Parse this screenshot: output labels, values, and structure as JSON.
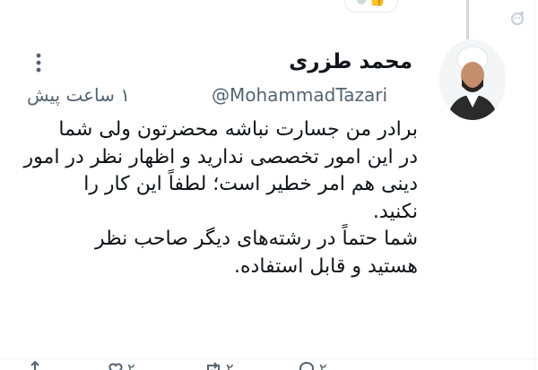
{
  "post": {
    "display_name": "محمد طزری",
    "handle": "@MohammadTazari",
    "time": "۱ ساعت پیش",
    "body": "برادر من جسارت نباشه محضرتون ولی شما\nدر این امور تخصصی ندارید و اظهار نظر در امور\nدینی هم امر خطیر است؛ لطفاً این کار را\nنکنید.\nشما حتماً در رشته‌های دیگر صاحب نظر\nهستید و قابل استفاده."
  },
  "actions": {
    "reply_count": "۲",
    "retweet_count": "۲",
    "like_count": "۲"
  },
  "colors": {
    "text": "#0f1419",
    "secondary": "#536471",
    "border": "#eff3f4",
    "thread_line": "#cfd9de"
  },
  "icons": [
    "more-vertical-icon",
    "add-reaction-icon",
    "reply-icon",
    "retweet-icon",
    "like-icon",
    "share-icon"
  ]
}
